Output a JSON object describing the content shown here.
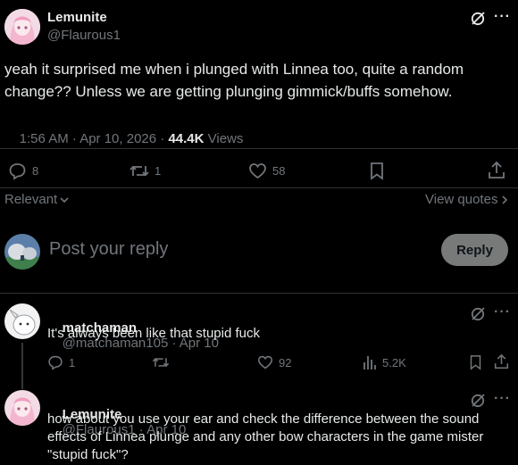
{
  "main_post": {
    "author_name": "Lemunite",
    "author_handle": "@Flaurous1",
    "text": "yeah it surprised me when i plunged with Linnea too, quite a random change?? Unless we are getting plunging  gimmick/buffs somehow.",
    "timestamp": "1:56 AM · Apr 10, 2026 · ",
    "views_count": "44.4K",
    "views_label": " Views",
    "replies": "8",
    "reposts": "1",
    "likes": "58"
  },
  "sort": {
    "label": "Relevant",
    "view_quotes": "View quotes"
  },
  "composer": {
    "placeholder": "Post your reply",
    "button_label": "Reply"
  },
  "replies": [
    {
      "author_name": "matchaman",
      "author_handle": "@matchaman105",
      "date": " · Apr 10",
      "text": "It's always been like that stupid fuck",
      "replies": "1",
      "reposts": "",
      "likes": "92",
      "views": "5.2K"
    },
    {
      "author_name": "Lemunite",
      "author_handle": "@Flaurous1",
      "date": " · Apr 10",
      "text": "how about you use your ear and check the difference between the sound effects of Linnea plunge and any other bow characters in the game mister \"stupid fuck\"?"
    }
  ],
  "icons": {
    "grok": "grok-icon",
    "more": "more-icon",
    "reply": "reply-icon",
    "repost": "repost-icon",
    "like": "heart-icon",
    "bookmark": "bookmark-icon",
    "share": "share-icon",
    "views": "views-icon"
  },
  "colors": {
    "background": "#000000",
    "text": "#e7e9ea",
    "muted": "#71767b",
    "divider": "#2f3336",
    "button_bg": "#787a7a"
  }
}
